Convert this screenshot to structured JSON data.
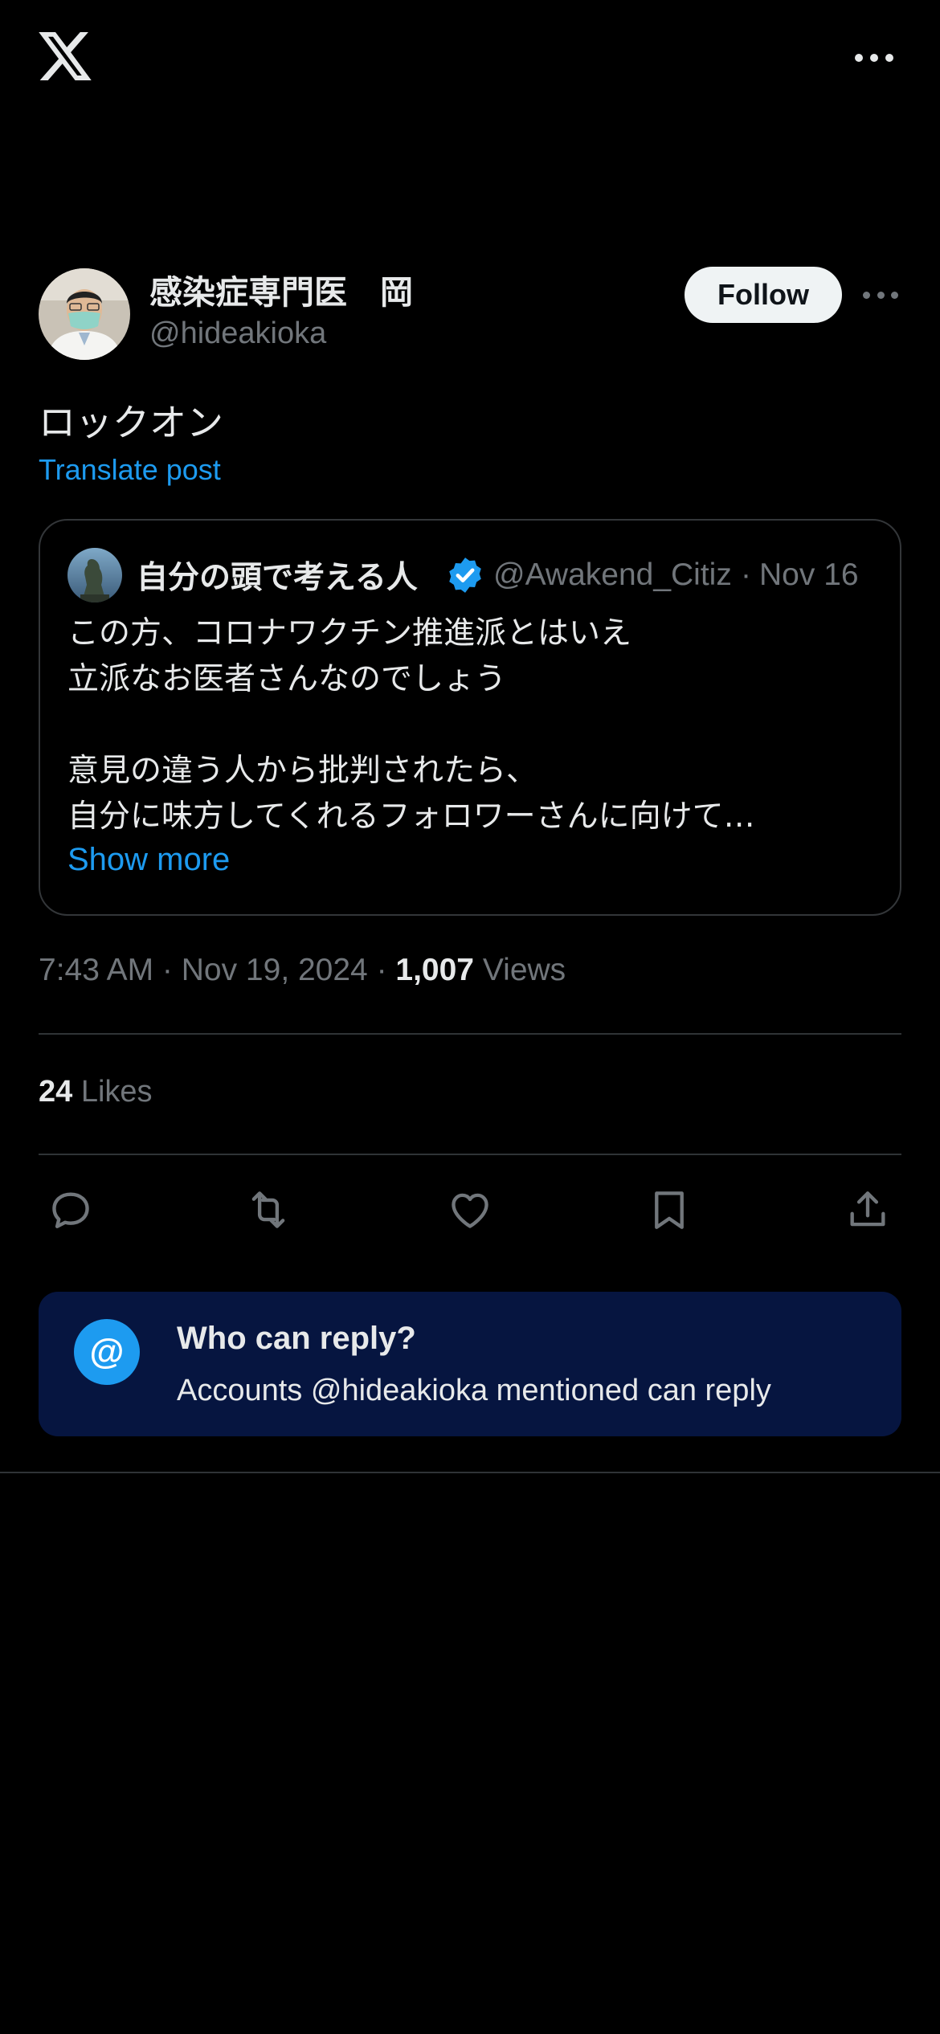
{
  "app": {
    "logo": "x-logo",
    "more_icon": "more-horizontal-icon"
  },
  "post": {
    "author": {
      "name": "感染症専門医　岡",
      "handle": "@hideakioka",
      "avatar": "doctor-avatar-photo"
    },
    "follow_label": "Follow",
    "text": "ロックオン",
    "translate_label": "Translate post",
    "quoted": {
      "author_name": "自分の頭で考える人　",
      "verified": true,
      "handle": "@Awakend_Citizen",
      "separator": "·",
      "date": "Nov 16",
      "body": "この方、コロナワクチン推進派とはいえ\n立派なお医者さんなのでしょう\n\n意見の違う人から批判されたら、\n自分に味方してくれるフォロワーさんに向けて…",
      "show_more_label": "Show more"
    },
    "timestamp": "7:43 AM · Nov 19, 2024 · ",
    "views_count": "1,007",
    "views_label": " Views",
    "likes_count": "24",
    "likes_label": " Likes"
  },
  "actions": [
    {
      "name": "reply",
      "icon": "reply-icon"
    },
    {
      "name": "repost",
      "icon": "repost-icon"
    },
    {
      "name": "like",
      "icon": "heart-icon"
    },
    {
      "name": "bookmark",
      "icon": "bookmark-icon"
    },
    {
      "name": "share",
      "icon": "share-icon"
    }
  ],
  "reply_settings": {
    "icon_glyph": "@",
    "title": "Who can reply?",
    "description": "Accounts @hideakioka mentioned can reply"
  },
  "colors": {
    "accent": "#1d9bf0",
    "background": "#000000",
    "muted": "#71767b",
    "reply_box": "#061540"
  }
}
